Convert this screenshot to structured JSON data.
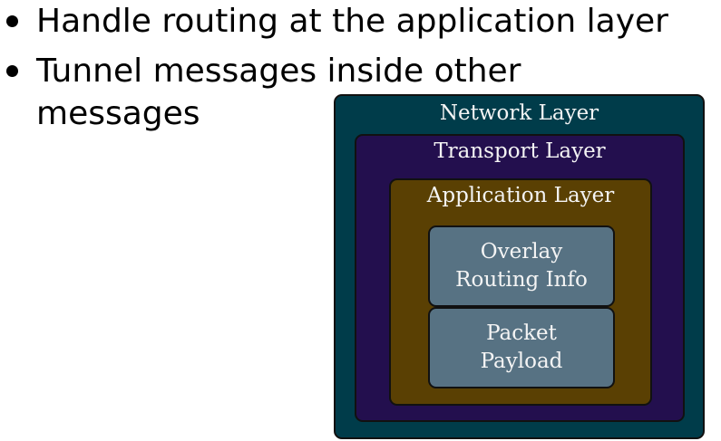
{
  "bullets": [
    "Handle routing at the application layer",
    "Tunnel messages inside other messages"
  ],
  "diagram": {
    "network_layer": "Network Layer",
    "transport_layer": "Transport Layer",
    "application_layer": "Application Layer",
    "overlay_routing_info": "Overlay Routing Info",
    "packet_payload": "Packet Payload",
    "colors": {
      "network": "#003c4a",
      "transport": "#230f4e",
      "application": "#5a4003",
      "inner_boxes": "#577283"
    }
  }
}
